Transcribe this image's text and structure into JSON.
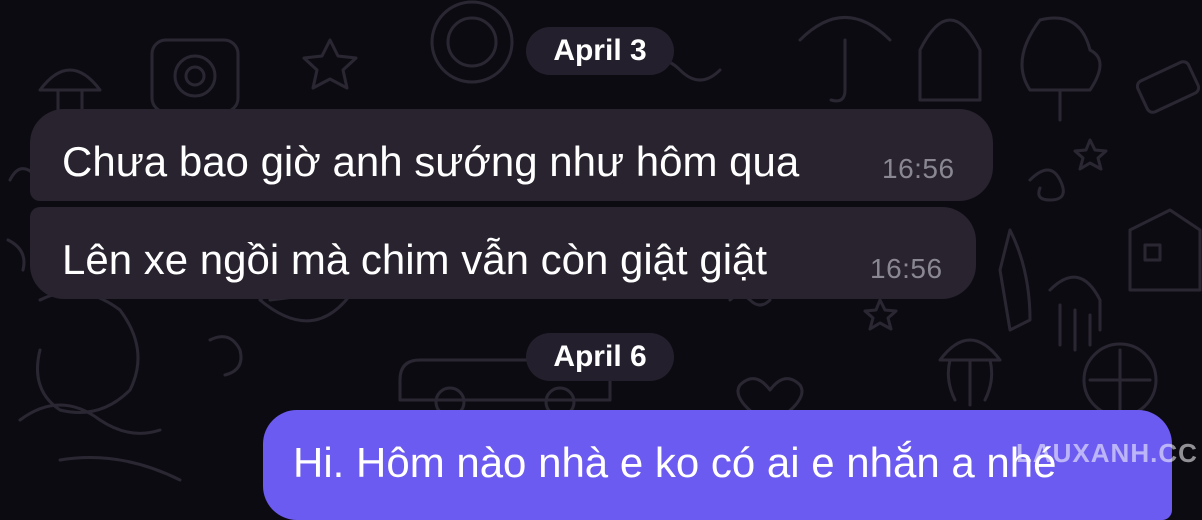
{
  "chat": {
    "date_1": "April 3",
    "messages_1": [
      {
        "text": "Chưa bao giờ anh sướng như hôm qua",
        "time": "16:56"
      },
      {
        "text": "Lên xe ngồi mà chim vẫn còn giật giật",
        "time": "16:56"
      }
    ],
    "date_2": "April 6",
    "outgoing": {
      "text": "Hi. Hôm nào nhà e ko có ai e nhắn a nhé"
    }
  },
  "watermark": "LAUXANH.CC",
  "colors": {
    "background": "#0d0b12",
    "incoming_bubble": "#28232f",
    "outgoing_bubble": "#6c5bf0",
    "date_pill": "#241f2c",
    "timestamp": "#8a8793"
  }
}
